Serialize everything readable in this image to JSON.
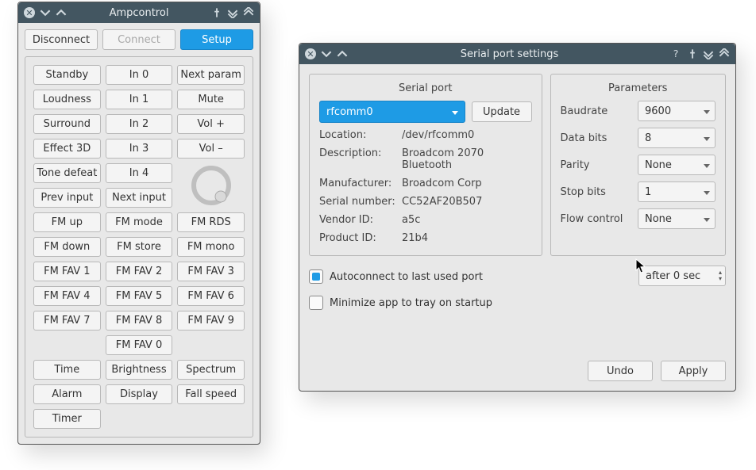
{
  "amp": {
    "title": "Ampcontrol",
    "top": {
      "disconnect": "Disconnect",
      "connect": "Connect",
      "setup": "Setup"
    },
    "buttons": {
      "standby": "Standby",
      "in0": "In 0",
      "next_param": "Next param",
      "loudness": "Loudness",
      "in1": "In 1",
      "mute": "Mute",
      "surround": "Surround",
      "in2": "In 2",
      "volp": "Vol +",
      "effect3d": "Effect 3D",
      "in3": "In 3",
      "volm": "Vol –",
      "tone_defeat": "Tone defeat",
      "in4": "In 4",
      "prev_input": "Prev input",
      "next_input": "Next input",
      "fm_up": "FM up",
      "fm_mode": "FM mode",
      "fm_rds": "FM RDS",
      "fm_down": "FM down",
      "fm_store": "FM store",
      "fm_mono": "FM mono",
      "fmf1": "FM FAV 1",
      "fmf2": "FM FAV 2",
      "fmf3": "FM FAV 3",
      "fmf4": "FM FAV 4",
      "fmf5": "FM FAV 5",
      "fmf6": "FM FAV 6",
      "fmf7": "FM FAV 7",
      "fmf8": "FM FAV 8",
      "fmf9": "FM FAV 9",
      "fmf0": "FM FAV 0",
      "time": "Time",
      "brightness": "Brightness",
      "spectrum": "Spectrum",
      "alarm": "Alarm",
      "display": "Display",
      "fall_speed": "Fall speed",
      "timer": "Timer"
    }
  },
  "serial": {
    "title": "Serial port settings",
    "panels": {
      "serial": "Serial port",
      "params": "Parameters"
    },
    "port_selected": "rfcomm0",
    "update": "Update",
    "info_labels": {
      "location": "Location:",
      "description": "Description:",
      "manufacturer": "Manufacturer:",
      "serial_number": "Serial number:",
      "vendor_id": "Vendor ID:",
      "product_id": "Product ID:"
    },
    "info": {
      "location": "/dev/rfcomm0",
      "description": "Broadcom 2070 Bluetooth",
      "manufacturer": "Broadcom Corp",
      "serial_number": "CC52AF20B507",
      "vendor_id": "a5c",
      "product_id": "21b4"
    },
    "param_labels": {
      "baudrate": "Baudrate",
      "databits": "Data bits",
      "parity": "Parity",
      "stopbits": "Stop bits",
      "flow": "Flow control"
    },
    "params": {
      "baudrate": "9600",
      "databits": "8",
      "parity": "None",
      "stopbits": "1",
      "flow": "None"
    },
    "autoconnect": "Autoconnect to last used port",
    "minimize": "Minimize app to tray on startup",
    "delay": "after 0 sec",
    "undo": "Undo",
    "apply": "Apply"
  }
}
